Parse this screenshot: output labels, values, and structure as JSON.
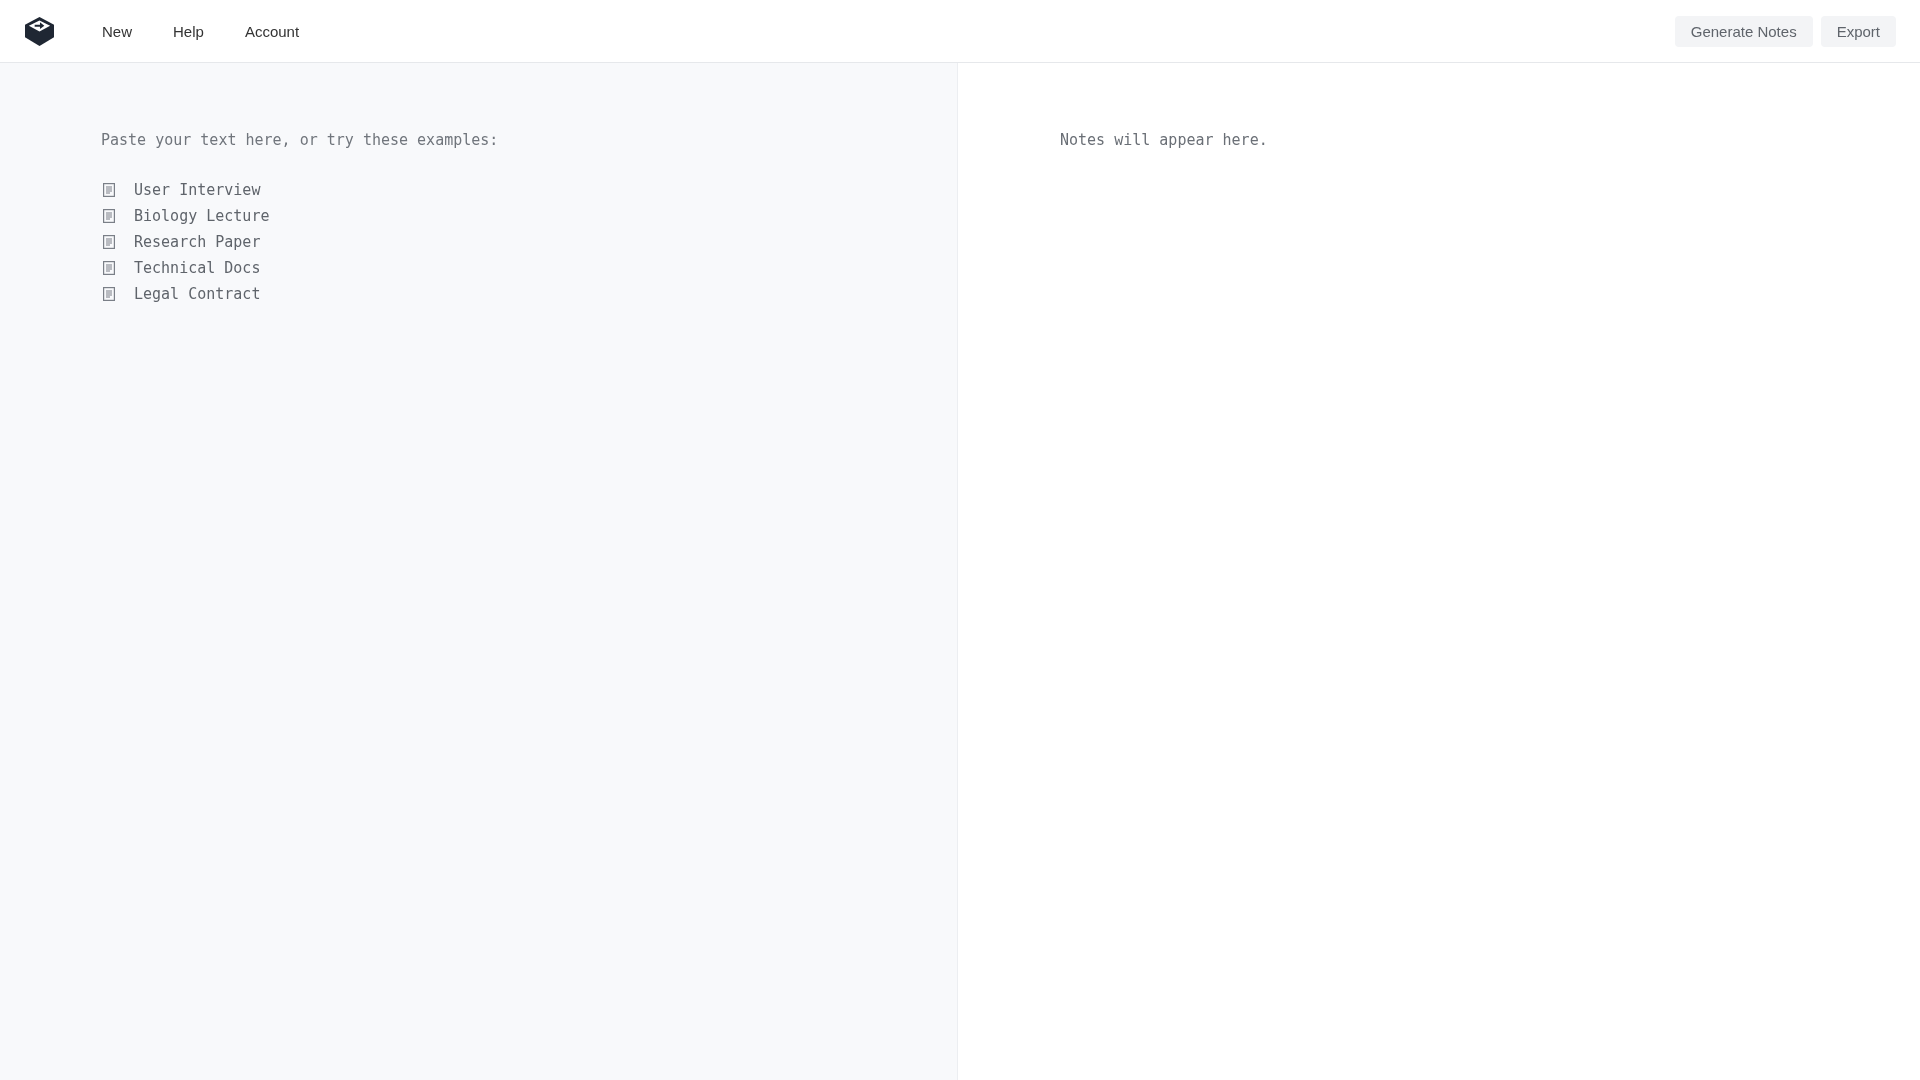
{
  "header": {
    "nav": [
      {
        "label": "New"
      },
      {
        "label": "Help"
      },
      {
        "label": "Account"
      }
    ],
    "actions": [
      {
        "label": "Generate Notes"
      },
      {
        "label": "Export"
      }
    ]
  },
  "editor": {
    "placeholder": "Paste your text here, or try these examples:",
    "examples": [
      "User Interview",
      "Biology Lecture",
      "Research Paper",
      "Technical Docs",
      "Legal Contract"
    ]
  },
  "notes": {
    "empty_message": "Notes will appear here."
  }
}
